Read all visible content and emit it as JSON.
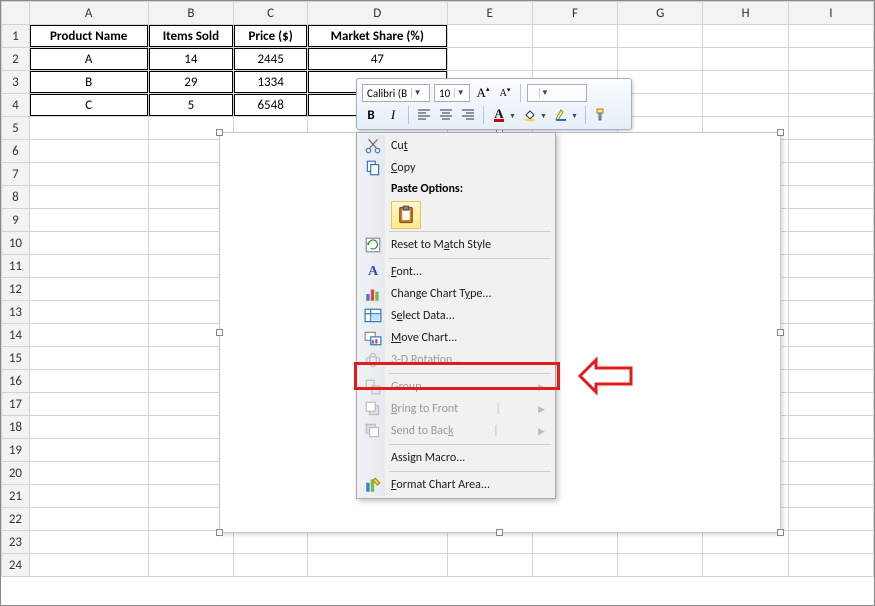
{
  "columns": [
    "A",
    "B",
    "C",
    "D",
    "E",
    "F",
    "G",
    "H",
    "I"
  ],
  "rows_count": 24,
  "table": {
    "headers": [
      "Product Name",
      "Items Sold",
      "Price ($)",
      "Market Share (%)"
    ],
    "rows": [
      {
        "name": "A",
        "items": "14",
        "price": "2445",
        "share": "47"
      },
      {
        "name": "B",
        "items": "29",
        "price": "1334",
        "share": ""
      },
      {
        "name": "C",
        "items": "5",
        "price": "6548",
        "share": ""
      }
    ]
  },
  "mini_toolbar": {
    "font_name": "Calibri (B",
    "font_size": "10",
    "grow_label": "A",
    "shrink_label": "A",
    "bold": "B",
    "italic": "I"
  },
  "context_menu": {
    "cut": "Cut",
    "copy": "Copy",
    "paste_options": "Paste Options:",
    "reset": "Reset to Match Style",
    "font": "Font...",
    "change_chart": "Change Chart Type...",
    "select_data": "Select Data...",
    "move_chart": "Move Chart...",
    "rotation3d": "3-D Rotation...",
    "group": "Group",
    "bring_front": "Bring to Front",
    "send_back": "Send to Back",
    "assign_macro": "Assign Macro...",
    "format_chart": "Format Chart Area..."
  }
}
